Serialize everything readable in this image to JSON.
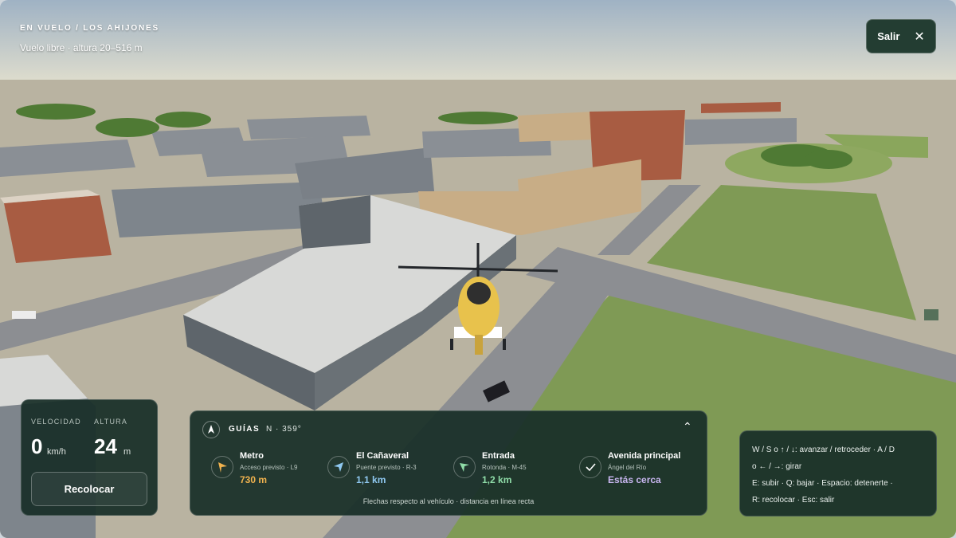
{
  "header": {
    "mode": "EN VUELO / LOS AHIJONES",
    "subtitle": "Vuelo libre · altura 20–516 m"
  },
  "exit_button": {
    "label": "Salir",
    "icon": "close-icon"
  },
  "telemetry": {
    "speed_label": "VELOCIDAD",
    "speed_value": "0",
    "speed_unit": "km/h",
    "altitude_label": "ALTURA",
    "altitude_value": "24",
    "altitude_unit": "m",
    "relocate_label": "Recolocar"
  },
  "guides": {
    "title": "GUÍAS",
    "heading": "N · 359°",
    "items": [
      {
        "name": "Metro",
        "desc": "Acceso previsto · L9",
        "distance": "730 m",
        "icon": "arrow-icon",
        "color": "#f0b24e"
      },
      {
        "name": "El Cañaveral",
        "desc": "Puente previsto · R-3",
        "distance": "1,1 km",
        "icon": "arrow-icon",
        "color": "#8fc8f0"
      },
      {
        "name": "Entrada",
        "desc": "Rotonda · M-45",
        "distance": "1,2 km",
        "icon": "arrow-icon",
        "color": "#8fdca8"
      },
      {
        "name": "Avenida principal",
        "desc": "Ángel del Río",
        "distance": "Estás cerca",
        "icon": "check-icon",
        "color": "#c8b6f0"
      }
    ],
    "footer": "Flechas respecto al vehículo · distancia en línea recta"
  },
  "keyboard_help": {
    "lines": [
      "W / S o ↑ / ↓: avanzar / retroceder · A / D",
      "o ← / →: girar",
      "E: subir · Q: bajar · Espacio: detenerte ·",
      "R: recolocar · Esc: salir"
    ]
  },
  "colors": {
    "panel": "#1d3a33",
    "accent_orange": "#f0b24e",
    "accent_blue": "#8fc8f0",
    "accent_green": "#8fdca8",
    "accent_violet": "#c8b6f0"
  }
}
